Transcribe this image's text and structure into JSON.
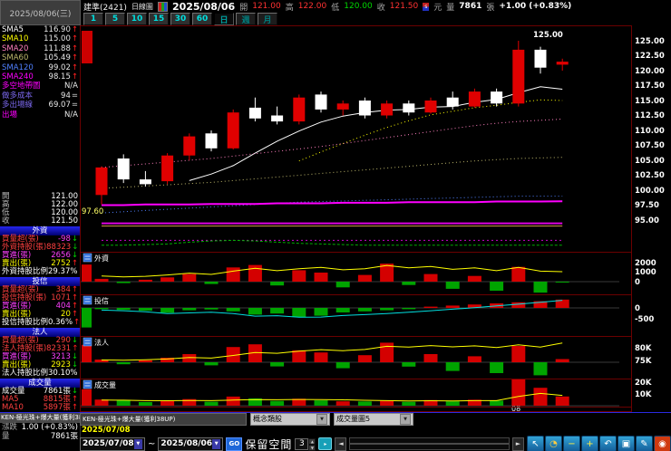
{
  "window": {
    "date": "2025/08/06(三)"
  },
  "quote": {
    "name": "建準(2421)",
    "chart_type": "日線圖",
    "date": "2025/08/06",
    "open_label": "開",
    "open": "121.00",
    "high_label": "高",
    "high": "122.00",
    "low_label": "低",
    "low": "120.00",
    "close_label": "收",
    "close": "121.50",
    "badge": "s",
    "unit": "元",
    "volume_label": "量",
    "volume": "7861",
    "volume_unit": "張",
    "change": "+1.00 (+0.83%)"
  },
  "toolbar": {
    "timeframes": [
      "1",
      "5",
      "10",
      "15",
      "30",
      "60"
    ],
    "day_label": "日",
    "week_label": "週",
    "month_label": "月"
  },
  "sidebar": {
    "ma_rows": [
      {
        "label": "SMA5",
        "value": "116.90",
        "arrow": "↑",
        "color": "#ffffff"
      },
      {
        "label": "SMA10",
        "value": "115.00",
        "arrow": "↑",
        "color": "#ffff00"
      },
      {
        "label": "SMA20",
        "value": "111.88",
        "arrow": "↑",
        "color": "#ff7fbf"
      },
      {
        "label": "SMA60",
        "value": "105.49",
        "arrow": "↑",
        "color": "#bdb76b"
      },
      {
        "label": "SMA120",
        "value": "99.02",
        "arrow": "↑",
        "color": "#5080ff"
      },
      {
        "label": "SMA240",
        "value": "98.15",
        "arrow": "↑",
        "color": "#ff00ff"
      }
    ],
    "extra_rows": [
      {
        "label": "多空地帶圖",
        "value": "N/A",
        "arrow": "",
        "color": "#ff00ff"
      },
      {
        "label": "做多成本",
        "value": "94",
        "arrow": "=",
        "color": "#7b68ee"
      },
      {
        "label": "多出場線",
        "value": "69.07",
        "arrow": "=",
        "color": "#7b68ee"
      },
      {
        "label": "出場",
        "value": "N/A",
        "arrow": "",
        "color": "#ff00ff"
      }
    ],
    "ohlc_rows": [
      {
        "label": "開",
        "value": "121.00"
      },
      {
        "label": "高",
        "value": "122.00"
      },
      {
        "label": "低",
        "value": "120.00"
      },
      {
        "label": "收",
        "value": "121.50"
      }
    ],
    "sections": [
      {
        "title": "外資",
        "rows": [
          {
            "label": "買量超(張)",
            "value": "-98",
            "arrow": "↓",
            "lcolor": "#ff4040",
            "vcolor": "#ff40ff"
          },
          {
            "label": "外資持股(張)",
            "value": "88323",
            "arrow": "↓",
            "lcolor": "#ff4040",
            "vcolor": "#ff4040"
          },
          {
            "label": "買進(張)",
            "value": "2656",
            "arrow": "↓",
            "lcolor": "#ff40ff",
            "vcolor": "#ff40ff"
          },
          {
            "label": "賣出(張)",
            "value": "2752",
            "arrow": "↑",
            "lcolor": "#ffff00",
            "vcolor": "#ffff00"
          },
          {
            "label": "外資持股比例",
            "value": "29.37%",
            "arrow": "↓",
            "lcolor": "#ffffff",
            "vcolor": "#ffffff"
          }
        ]
      },
      {
        "title": "投信",
        "rows": [
          {
            "label": "買量超(張)",
            "value": "384",
            "arrow": "↑",
            "lcolor": "#ff4040",
            "vcolor": "#ff4040"
          },
          {
            "label": "投信持股(張)",
            "value": "1071",
            "arrow": "↑",
            "lcolor": "#ff4040",
            "vcolor": "#ff4040"
          },
          {
            "label": "買進(張)",
            "value": "404",
            "arrow": "↑",
            "lcolor": "#ff40ff",
            "vcolor": "#ff40ff"
          },
          {
            "label": "賣出(張)",
            "value": "20",
            "arrow": "↑",
            "lcolor": "#ffff00",
            "vcolor": "#ffff00"
          },
          {
            "label": "投信持股比例",
            "value": "0.36%",
            "arrow": "↑",
            "lcolor": "#ffffff",
            "vcolor": "#ffffff"
          }
        ]
      },
      {
        "title": "法人",
        "rows": [
          {
            "label": "買量超(張)",
            "value": "290",
            "arrow": "↓",
            "lcolor": "#ff4040",
            "vcolor": "#ff4040"
          },
          {
            "label": "法人持股(張)",
            "value": "82331",
            "arrow": "↑",
            "lcolor": "#ff4040",
            "vcolor": "#ff4040"
          },
          {
            "label": "買進(張)",
            "value": "3213",
            "arrow": "↓",
            "lcolor": "#ff40ff",
            "vcolor": "#ff40ff"
          },
          {
            "label": "賣出(張)",
            "value": "2923",
            "arrow": "↓",
            "lcolor": "#ffff00",
            "vcolor": "#ffff00"
          },
          {
            "label": "法人持股比例",
            "value": "30.10%",
            "arrow": "↑",
            "lcolor": "#ffffff",
            "vcolor": "#ffffff"
          }
        ]
      },
      {
        "title": "成交量",
        "rows": [
          {
            "label": "成交量",
            "value": "7861張",
            "arrow": "↓",
            "lcolor": "#ffffff",
            "vcolor": "#ffffff"
          },
          {
            "label": "MA5",
            "value": "8815張",
            "arrow": "↑",
            "lcolor": "#ff4040",
            "vcolor": "#ff4040"
          },
          {
            "label": "MA10",
            "value": "5897張",
            "arrow": "↑",
            "lcolor": "#ff4040",
            "vcolor": "#ff4040"
          }
        ]
      }
    ]
  },
  "bottom": {
    "indicator_title": "KEN-極光珠+爆大量(獲利38UP)",
    "change_label": "漲跌",
    "change_value": "1.00 (+0.83%)",
    "volume_label": "量",
    "volume_value": "7861張",
    "tab_label": "KEN-極光珠+爆大量(獲利38UP)",
    "combo1": "概念類股",
    "combo2": "成交量圖5",
    "dropdown_arrow": "▼",
    "range_start": "2025/07/08",
    "date_from": "2025/07/08",
    "date_to": "2025/08/06",
    "tilde": "~",
    "go_label": "GO",
    "reserve_label": "保留空間",
    "reserve_value": "3",
    "spinner_up": "▲",
    "spinner_down": "▼",
    "apply_glyph": "▸",
    "scroll_left": "◄",
    "scroll_right": "►",
    "icons": [
      {
        "name": "cursor-icon",
        "glyph": "↖",
        "fg": "#ffffff",
        "bg": ""
      },
      {
        "name": "clock-icon",
        "glyph": "◔",
        "fg": "#ffcc40",
        "bg": ""
      },
      {
        "name": "zoom-out-icon",
        "glyph": "−",
        "fg": "#ffee44",
        "bg": ""
      },
      {
        "name": "zoom-in-icon",
        "glyph": "+",
        "fg": "#ffee44",
        "bg": ""
      },
      {
        "name": "undo-icon",
        "glyph": "↶",
        "fg": "#ffffff",
        "bg": ""
      },
      {
        "name": "window-icon",
        "glyph": "▣",
        "fg": "#ffffff",
        "bg": ""
      },
      {
        "name": "draw-icon",
        "glyph": "✎",
        "fg": "#ffffff",
        "bg": ""
      },
      {
        "name": "alert-icon",
        "glyph": "◉",
        "fg": "#ffffff",
        "bg": "#d03a10"
      }
    ]
  },
  "chart_data": {
    "type": "candlestick",
    "symbol": "建準(2421)",
    "date_range": "2025/07/08 - 2025/08/06",
    "up_color": "#e00000",
    "down_color": "#ffffff",
    "price_axis": {
      "min": 95,
      "max": 125,
      "ticks": [
        {
          "v": 125,
          "t": "125.00"
        },
        {
          "v": 122.5,
          "t": "122.50"
        },
        {
          "v": 120,
          "t": "120.00"
        },
        {
          "v": 117.5,
          "t": "117.50"
        },
        {
          "v": 115,
          "t": "115.00"
        },
        {
          "v": 112.5,
          "t": "112.50"
        },
        {
          "v": 110,
          "t": "110.00"
        },
        {
          "v": 107.5,
          "t": "107.50"
        },
        {
          "v": 105,
          "t": "105.00"
        },
        {
          "v": 102.5,
          "t": "102.50"
        },
        {
          "v": 100,
          "t": "100.00"
        },
        {
          "v": 97.5,
          "t": "97.50"
        },
        {
          "v": 95,
          "t": "95.00"
        }
      ]
    },
    "annotations": {
      "high_label": "125.00",
      "low_label": "97.60",
      "month_label": "08"
    },
    "candles": [
      [
        99.2,
        104,
        97.6,
        103.8
      ],
      [
        105.3,
        106,
        101.2,
        101.8
      ],
      [
        101.8,
        103.2,
        100.6,
        101
      ],
      [
        101.5,
        106.2,
        101,
        105.8
      ],
      [
        105.8,
        109.5,
        105,
        109
      ],
      [
        109.5,
        110,
        106.5,
        107
      ],
      [
        107,
        113.5,
        106.8,
        113
      ],
      [
        113.8,
        115.5,
        111.5,
        112
      ],
      [
        112.5,
        114,
        111,
        111.5
      ],
      [
        111.5,
        116,
        111,
        115.5
      ],
      [
        116,
        116.5,
        113,
        113.5
      ],
      [
        113.5,
        115,
        112.5,
        114.5
      ],
      [
        115,
        115.5,
        112,
        112.5
      ],
      [
        112.5,
        115,
        112,
        114.5
      ],
      [
        114.5,
        115,
        112.5,
        113
      ],
      [
        113,
        115.5,
        112.8,
        115
      ],
      [
        115.5,
        116.5,
        113.5,
        114
      ],
      [
        114,
        117,
        113.8,
        116.5
      ],
      [
        116.5,
        117,
        114,
        114.5
      ],
      [
        114.5,
        125,
        114,
        123.5
      ],
      [
        123.5,
        124,
        119.5,
        120.5
      ],
      [
        121,
        122,
        120,
        121.5
      ]
    ],
    "ma_series": [
      {
        "name": "SMA5",
        "color": "#ffffff",
        "dash": "",
        "width": 1,
        "values": [
          null,
          null,
          null,
          null,
          101.6,
          102.7,
          104.1,
          106.2,
          108.2,
          109.9,
          111.4,
          112.4,
          113,
          113.4,
          113.5,
          113.9,
          114,
          114.7,
          115.2,
          116.3,
          117.3,
          116.9
        ]
      },
      {
        "name": "SMA10",
        "color": "#ffff00",
        "dash": "1,3",
        "width": 1,
        "values": [
          null,
          null,
          null,
          null,
          null,
          null,
          null,
          null,
          null,
          104.9,
          106.4,
          107.8,
          109.2,
          110.5,
          111.6,
          112.6,
          113.2,
          113.8,
          114.2,
          114.7,
          115.1,
          115
        ]
      },
      {
        "name": "SMA20",
        "color": "#ff7fbf",
        "dash": "1,3",
        "width": 1,
        "values": [
          103.8,
          104.1,
          104.4,
          104.7,
          105,
          105.3,
          105.7,
          106.1,
          106.5,
          106.9,
          107.3,
          107.8,
          108.3,
          108.8,
          109.3,
          109.8,
          110.3,
          110.8,
          111.2,
          111.5,
          111.7,
          111.9
        ]
      },
      {
        "name": "SMA60",
        "color": "#bdb76b",
        "dash": "1,3",
        "width": 1,
        "values": [
          100.3,
          100.5,
          100.7,
          100.9,
          101.1,
          101.3,
          101.6,
          101.9,
          102.2,
          102.5,
          102.8,
          103.1,
          103.4,
          103.7,
          104,
          104.3,
          104.6,
          104.9,
          105.1,
          105.3,
          105.4,
          105.5
        ]
      },
      {
        "name": "SMA120",
        "color": "#5080ff",
        "dash": "1,3",
        "width": 1,
        "values": [
          96.2,
          96.4,
          96.6,
          96.8,
          97,
          97.2,
          97.4,
          97.6,
          97.8,
          98,
          98.1,
          98.2,
          98.3,
          98.4,
          98.5,
          98.6,
          98.7,
          98.8,
          98.9,
          99,
          99,
          99
        ]
      },
      {
        "name": "SMA240",
        "color": "#ff00ff",
        "dash": "",
        "width": 2,
        "values": [
          97.5,
          97.5,
          97.6,
          97.6,
          97.6,
          97.7,
          97.7,
          97.7,
          97.8,
          97.8,
          97.8,
          97.9,
          97.9,
          97.9,
          98,
          98,
          98,
          98,
          98.1,
          98.1,
          98.1,
          98.15
        ]
      }
    ],
    "aux_lines": [
      {
        "name": "cost-line",
        "color": "#d8a048",
        "dash": "",
        "width": 1,
        "flat": 94.0
      },
      {
        "name": "cost-band",
        "color": "#e000e0",
        "dash": "",
        "width": 2,
        "flat": 94.45
      },
      {
        "name": "exit-band",
        "color": "#cc00cc",
        "dash": "2,3",
        "width": 1,
        "flat": 91.6
      },
      {
        "name": "trend-band",
        "color": "#00b000",
        "dash": "3,2",
        "width": 1,
        "values": [
          90.8,
          90.8,
          90.9,
          91,
          91.3,
          91.5,
          91.6,
          91.5,
          91.3,
          91.1,
          91,
          90.9,
          90.8,
          90.8,
          90.8,
          90.8,
          90.8,
          90.8,
          90.8,
          90.8,
          90.8,
          90.8
        ]
      }
    ],
    "panels": [
      {
        "label": "外資",
        "ticks": [
          {
            "v": 2000,
            "t": "2000"
          },
          {
            "v": 1000,
            "t": "1000"
          },
          {
            "v": 0,
            "t": "0"
          }
        ],
        "bars": [
          300,
          -150,
          200,
          450,
          800,
          -250,
          1500,
          1750,
          -400,
          1200,
          950,
          -600,
          700,
          1900,
          -350,
          800,
          -750,
          600,
          -950,
          1550,
          -1150,
          -98
        ],
        "edge_bar": 1800,
        "line_color": "#ffff00",
        "line": [
          600,
          500,
          560,
          700,
          900,
          760,
          1100,
          1400,
          1150,
          1350,
          1500,
          1250,
          1350,
          1700,
          1450,
          1600,
          1300,
          1450,
          1150,
          1500,
          1100,
          1050
        ]
      },
      {
        "label": "投信",
        "ticks": [
          {
            "v": 0,
            "t": "0"
          },
          {
            "v": -500,
            "t": "-500"
          }
        ],
        "bars": [
          -60,
          -90,
          -130,
          -220,
          -110,
          -70,
          -160,
          -310,
          -260,
          -420,
          -360,
          -210,
          -160,
          -110,
          -60,
          60,
          110,
          160,
          210,
          260,
          310,
          384
        ],
        "edge_bar": -900,
        "line_color": "#00e0e0",
        "line": [
          -100,
          -130,
          -180,
          -260,
          -230,
          -200,
          -260,
          -380,
          -360,
          -430,
          -420,
          -350,
          -310,
          -260,
          -200,
          -130,
          -60,
          10,
          90,
          170,
          260,
          350
        ]
      },
      {
        "label": "法人",
        "ticks": [
          {
            "v": 80,
            "t": "80K"
          },
          {
            "v": 75,
            "t": "75K"
          }
        ],
        "bars": [
          250,
          -180,
          180,
          420,
          750,
          -280,
          1400,
          1650,
          -380,
          1100,
          900,
          -550,
          650,
          1800,
          -400,
          750,
          -800,
          550,
          -1000,
          1500,
          -1200,
          290
        ],
        "edge_bar": 1600,
        "line_color": "#ffff00",
        "line": [
          75.2,
          75.1,
          75.3,
          75.6,
          76.2,
          76,
          77.1,
          78.3,
          78,
          78.9,
          79.5,
          79.1,
          79.6,
          80.9,
          80.6,
          81.2,
          80.7,
          81.1,
          80.4,
          81.5,
          80.6,
          82.3
        ]
      },
      {
        "label": "成交量",
        "ticks": [
          {
            "v": 20000,
            "t": "20K"
          },
          {
            "v": 10000,
            "t": "10K"
          }
        ],
        "bars": [
          5200,
          4800,
          3100,
          3900,
          5600,
          3400,
          7800,
          6200,
          4100,
          5900,
          4500,
          3800,
          3600,
          4200,
          3300,
          4800,
          3700,
          5100,
          4300,
          22500,
          15200,
          7861
        ],
        "dirs": [
          "u",
          "d",
          "d",
          "u",
          "u",
          "d",
          "u",
          "d",
          "d",
          "u",
          "d",
          "u",
          "d",
          "u",
          "d",
          "u",
          "d",
          "u",
          "d",
          "u",
          "u",
          "u"
        ],
        "edge_bar": 14000,
        "line_color": "#ffff00",
        "line": [
          4800,
          4700,
          4300,
          4200,
          4400,
          4300,
          4800,
          5200,
          5100,
          5300,
          5200,
          5000,
          4600,
          4300,
          4000,
          4200,
          4100,
          4300,
          4300,
          7900,
          10500,
          8800
        ]
      }
    ]
  }
}
